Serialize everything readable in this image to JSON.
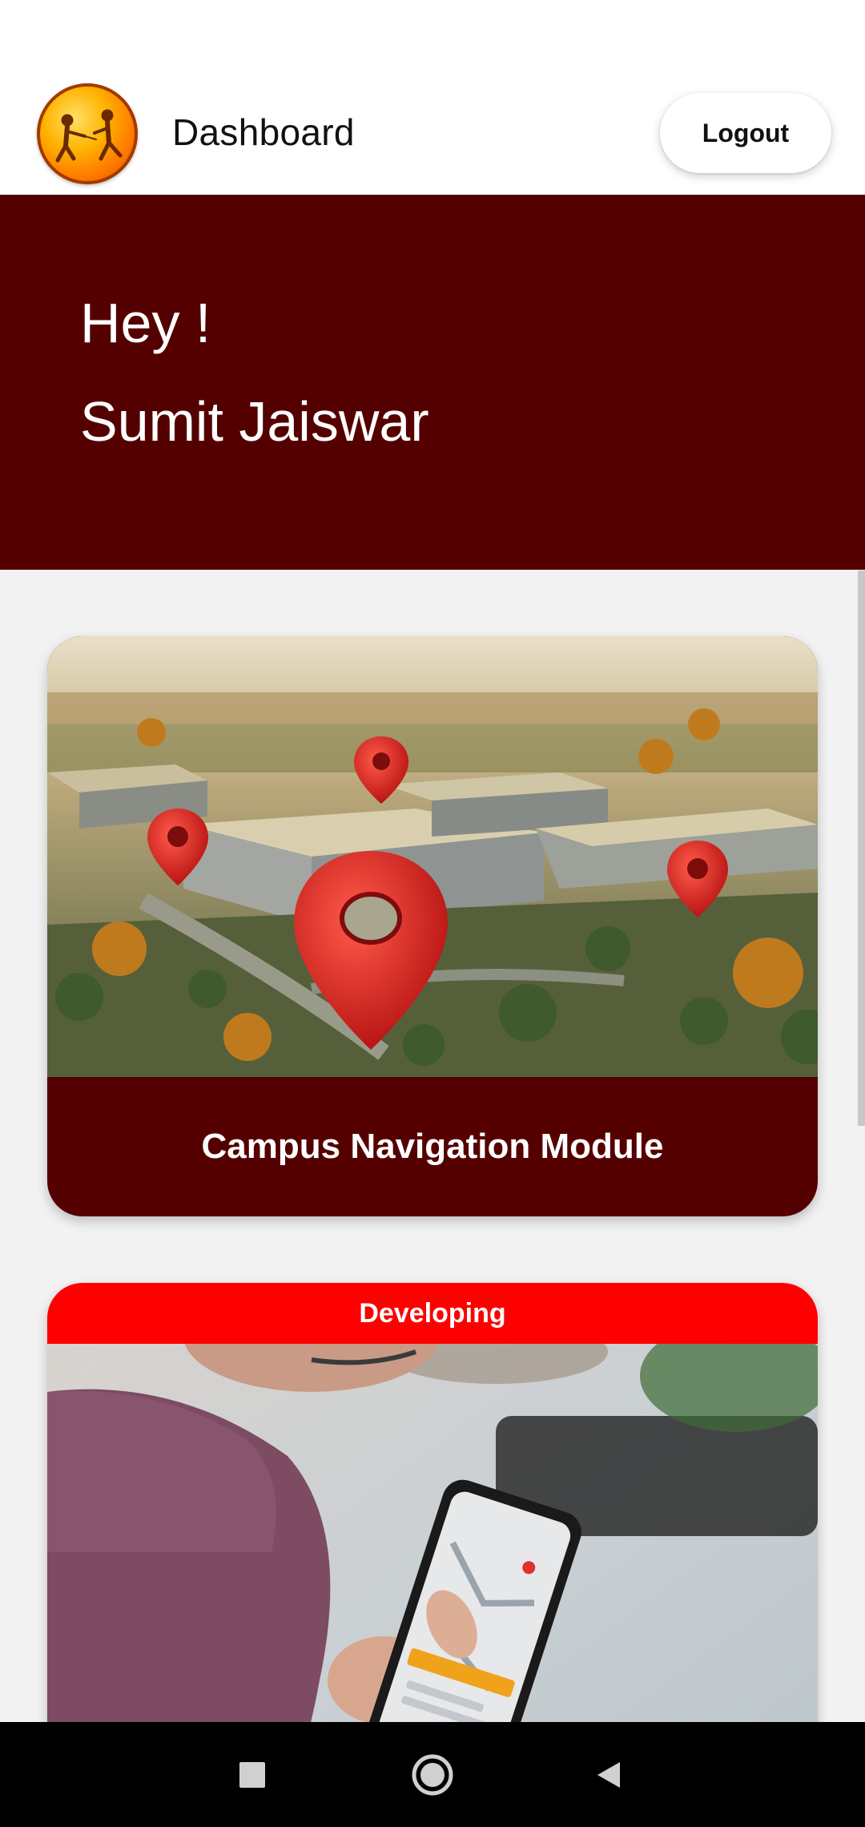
{
  "header": {
    "title": "Dashboard",
    "logout_label": "Logout"
  },
  "greeting": {
    "line1": "Hey !",
    "line2": "Sumit Jaiswar"
  },
  "modules": [
    {
      "label": "Campus Navigation Module",
      "image_icon": "campus-map-pins-image"
    },
    {
      "badge": "Developing",
      "image_icon": "phone-navigation-image"
    }
  ],
  "colors": {
    "brand_dark_red": "#550000",
    "badge_red": "#ff0000",
    "background": "#f2f2f2"
  },
  "system_nav": {
    "icons": [
      "recents-square-icon",
      "home-circle-icon",
      "back-triangle-icon"
    ]
  }
}
